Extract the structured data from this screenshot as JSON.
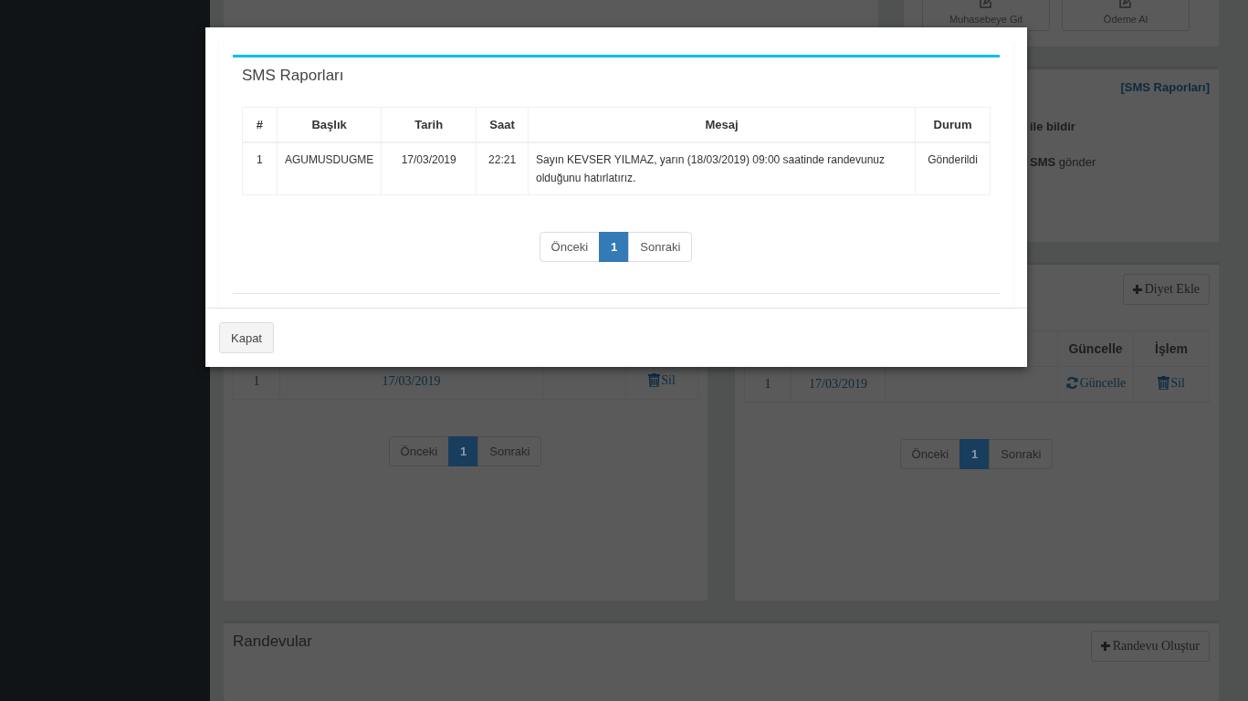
{
  "background": {
    "actions": [
      {
        "label": "Muhasebeye Git"
      },
      {
        "label": "Ödeme Al"
      }
    ],
    "sms_panel": {
      "link": "[SMS Raporları]",
      "lines": [
        "ile bildir",
        "**SMS** gönder"
      ]
    },
    "left_panel": {
      "rows": [
        {
          "number": "1",
          "date": "17/03/2019",
          "delete": "Sil"
        }
      ],
      "pagination": {
        "previous": "Önceki",
        "pages": [
          {
            "label": "1",
            "selected": true
          }
        ],
        "next": "Sonraki"
      }
    },
    "diet_panel": {
      "add_button": "Diyet Ekle",
      "columns": [
        "Güncelle",
        "İşlem"
      ],
      "rows": [
        {
          "number": "1",
          "date": "17/03/2019",
          "update": "Güncelle",
          "delete": "Sil"
        }
      ],
      "pagination": {
        "previous": "Önceki",
        "pages": [
          {
            "label": "1",
            "selected": true
          }
        ],
        "next": "Sonraki"
      }
    },
    "appointments": {
      "title": "Randevular",
      "create_button": "Randevu Oluştur"
    }
  },
  "modal": {
    "title": "SMS Raporları",
    "table": {
      "columns": [
        "#",
        "Başlık",
        "Tarih",
        "Saat",
        "Mesaj",
        "Durum"
      ],
      "rows": [
        [
          "1",
          "AGUMUSDUGME",
          "17/03/2019",
          "22:21",
          "Sayın KEVSER YILMAZ, yarın (18/03/2019) 09:00 saatinde randevunuz olduğunu hatırlatırız.",
          "Gönderildi"
        ]
      ]
    },
    "pagination": {
      "previous": "Önceki",
      "pages": [
        {
          "label": "1",
          "selected": true
        }
      ],
      "next": "Sonraki"
    },
    "close_button": "Kapat"
  }
}
